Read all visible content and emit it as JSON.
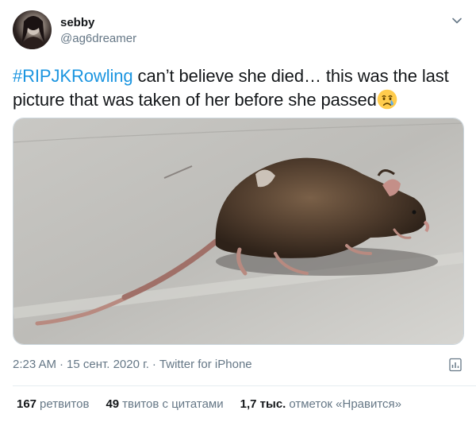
{
  "author": {
    "name": "sebby",
    "handle": "@ag6dreamer"
  },
  "tweet": {
    "hashtag": "#RIPJKRowling",
    "text": " can’t believe she died… this was the last picture that was taken of her before she passed",
    "emoji": "crying-face-emoji"
  },
  "meta": {
    "time": "2:23 AM",
    "date": "15 сент. 2020 г.",
    "separator": "·",
    "source": "Twitter for iPhone"
  },
  "stats": {
    "retweets_count": "167",
    "retweets_label": "ретвитов",
    "quotes_count": "49",
    "quotes_label": "твитов с цитатами",
    "likes_count": "1,7 тыс.",
    "likes_label": "отметок «Нравится»"
  },
  "colors": {
    "link": "#1b95e0",
    "secondary_text": "#657786",
    "primary_text": "#14171a",
    "border": "#e6ecf0"
  },
  "icons": {
    "menu": "chevron-down-icon",
    "analytics": "analytics-icon"
  }
}
